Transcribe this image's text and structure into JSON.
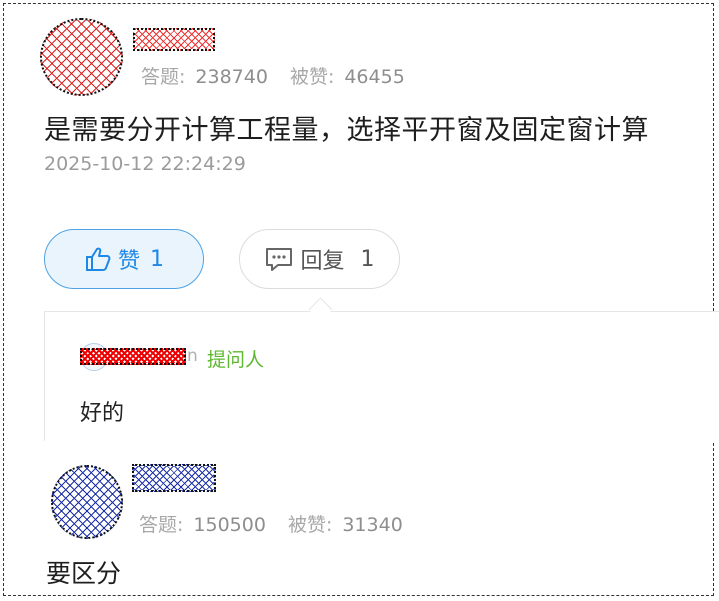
{
  "answer1": {
    "avatar": "user-avatar-redacted",
    "stats": {
      "answers_label": "答题:",
      "answers_value": "238740",
      "likes_label": "被赞:",
      "likes_value": "46455"
    },
    "text": "是需要分开计算工程量，选择平开窗及固定窗计算",
    "timestamp": "2025-10-12 22:24:29",
    "like_button": {
      "label": "赞",
      "count": "1",
      "icon": "thumbs-up-icon"
    },
    "reply_button": {
      "label": "回复",
      "count": "1",
      "icon": "comment-icon"
    }
  },
  "reply": {
    "name_tail": "n",
    "tag": "提问人",
    "text": "好的"
  },
  "answer2": {
    "avatar": "user-avatar-redacted",
    "stats": {
      "answers_label": "答题:",
      "answers_value": "150500",
      "likes_label": "被赞:",
      "likes_value": "31340"
    },
    "text": "要区分"
  },
  "colors": {
    "accent_blue": "#1e88e5",
    "asker_green": "#5cb82e",
    "muted_gray": "#9a9a9a"
  }
}
